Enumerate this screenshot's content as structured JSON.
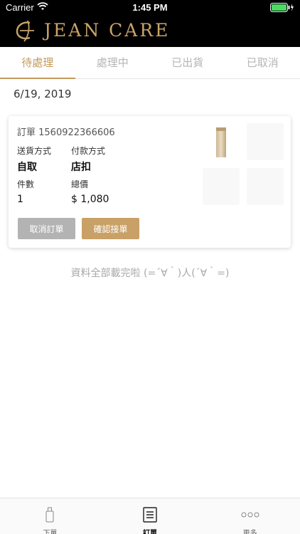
{
  "status_bar": {
    "carrier": "Carrier",
    "time": "1:45 PM"
  },
  "brand": {
    "name": "JEAN CARE",
    "color": "#c9a36a"
  },
  "tabs": [
    {
      "label": "待處理",
      "active": true
    },
    {
      "label": "處理中",
      "active": false
    },
    {
      "label": "已出貨",
      "active": false
    },
    {
      "label": "已取消",
      "active": false
    }
  ],
  "date": "6/19, 2019",
  "order": {
    "number_text": "訂單 1560922366606",
    "shipping_label": "送貨方式",
    "shipping_value": "自取",
    "payment_label": "付款方式",
    "payment_value": "店扣",
    "count_label": "件數",
    "count_value": "1",
    "total_label": "總價",
    "total_value": "$ 1,080",
    "cancel_button": "取消訂單",
    "confirm_button": "確認接單",
    "thumbnail_count": 4
  },
  "end_message": "資料全部載完啦 (=´∀｀)人(´∀｀=)",
  "tab_bar": {
    "items": [
      {
        "label": "下單",
        "icon": "bottle-icon",
        "active": false
      },
      {
        "label": "訂單",
        "icon": "order-list-icon",
        "active": true
      },
      {
        "label": "更多",
        "icon": "more-dots-icon",
        "active": false
      }
    ]
  },
  "colors": {
    "accent": "#c39a5d",
    "confirm_button": "#c9a066",
    "cancel_button": "#b3b3b3"
  }
}
